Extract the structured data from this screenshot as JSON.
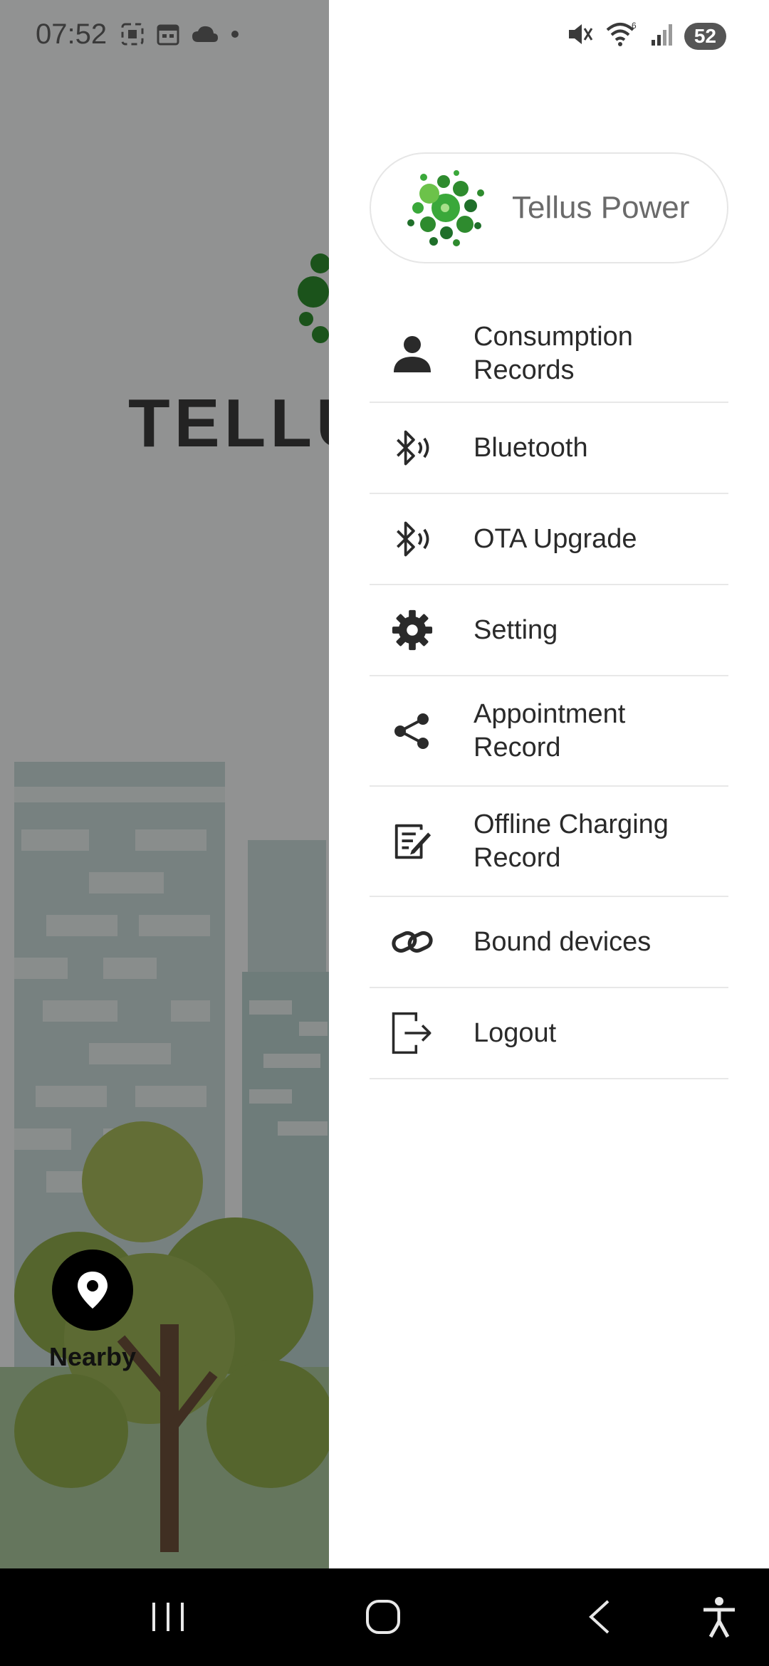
{
  "status_bar": {
    "time": "07:52",
    "battery": "52",
    "left_icons": [
      "screenshot-icon",
      "calendar-icon",
      "cloud-icon",
      "dot-icon"
    ],
    "right_icons": [
      "mute-icon",
      "wifi-icon",
      "signal-icon"
    ]
  },
  "background": {
    "logo_text": "TELLU",
    "nearby_label": "Nearby"
  },
  "drawer": {
    "brand_name": "Tellus Power",
    "items": [
      {
        "label": "Consumption\nRecords",
        "icon": "person-icon"
      },
      {
        "label": "Bluetooth",
        "icon": "bluetooth-icon"
      },
      {
        "label": "OTA Upgrade",
        "icon": "bluetooth-icon"
      },
      {
        "label": "Setting",
        "icon": "gear-icon"
      },
      {
        "label": "Appointment\nRecord",
        "icon": "share-icon"
      },
      {
        "label": "Offline Charging\nRecord",
        "icon": "edit-note-icon"
      },
      {
        "label": "Bound devices",
        "icon": "link-icon"
      },
      {
        "label": "Logout",
        "icon": "logout-icon"
      }
    ]
  },
  "nav_bar": {
    "buttons": [
      "recent-apps",
      "home",
      "back",
      "accessibility"
    ]
  }
}
